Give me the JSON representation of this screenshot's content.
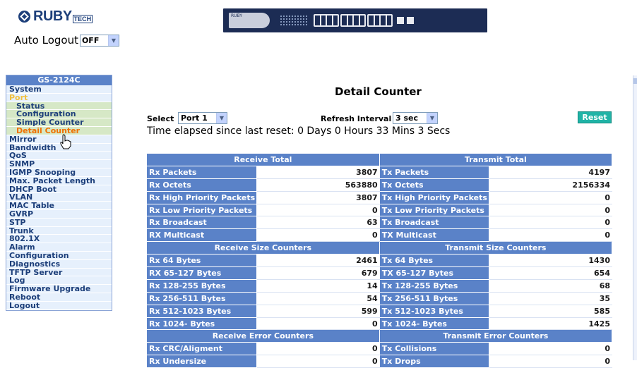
{
  "header": {
    "logo_text": "RUBY",
    "logo_sub": "TECH",
    "auto_logout_label": "Auto Logout",
    "auto_logout_value": "OFF",
    "switch_brand": "RUBY"
  },
  "sidebar": {
    "title": "GS-2124C",
    "items": [
      {
        "label": "System"
      },
      {
        "label": "Port",
        "open": true
      },
      {
        "label": "Status",
        "sub": true
      },
      {
        "label": "Configuration",
        "sub": true
      },
      {
        "label": "Simple Counter",
        "sub": true
      },
      {
        "label": "Detail Counter",
        "sub": true,
        "active": true
      },
      {
        "label": "Mirror"
      },
      {
        "label": "Bandwidth"
      },
      {
        "label": "QoS"
      },
      {
        "label": "SNMP"
      },
      {
        "label": "IGMP Snooping"
      },
      {
        "label": "Max. Packet Length"
      },
      {
        "label": "DHCP Boot"
      },
      {
        "label": "VLAN"
      },
      {
        "label": "MAC Table"
      },
      {
        "label": "GVRP"
      },
      {
        "label": "STP"
      },
      {
        "label": "Trunk"
      },
      {
        "label": "802.1X"
      },
      {
        "label": "Alarm"
      },
      {
        "label": "Configuration"
      },
      {
        "label": "Diagnostics"
      },
      {
        "label": "TFTP Server"
      },
      {
        "label": "Log"
      },
      {
        "label": "Firmware Upgrade"
      },
      {
        "label": "Reboot"
      },
      {
        "label": "Logout"
      }
    ]
  },
  "main": {
    "title": "Detail Counter",
    "select_label": "Select",
    "port_value": "Port 1",
    "refresh_label": "Refresh Interval",
    "refresh_value": "3 sec",
    "reset_label": "Reset",
    "elapsed": "Time elapsed since last reset: 0 Days 0 Hours 33 Mins 3 Secs"
  },
  "table": [
    {
      "type": "header",
      "left": "Receive Total",
      "right": "Transmit Total"
    },
    {
      "type": "row",
      "l_label": "Rx Packets",
      "l_value": "3807",
      "r_label": "Tx Packets",
      "r_value": "4197"
    },
    {
      "type": "row",
      "l_label": "Rx Octets",
      "l_value": "563880",
      "r_label": "Tx Octets",
      "r_value": "2156334"
    },
    {
      "type": "row",
      "l_label": "Rx High Priority Packets",
      "l_value": "3807",
      "r_label": "Tx High Priority Packets",
      "r_value": "0"
    },
    {
      "type": "row",
      "l_label": "Rx Low Priority Packets",
      "l_value": "0",
      "r_label": "Tx Low Priority Packets",
      "r_value": "0"
    },
    {
      "type": "row",
      "l_label": "Rx Broadcast",
      "l_value": "63",
      "r_label": "Tx Broadcast",
      "r_value": "0"
    },
    {
      "type": "row",
      "l_label": "RX Multicast",
      "l_value": "0",
      "r_label": "TX Multicast",
      "r_value": "0"
    },
    {
      "type": "header",
      "left": "Receive Size Counters",
      "right": "Transmit Size Counters"
    },
    {
      "type": "row",
      "l_label": "Rx 64 Bytes",
      "l_value": "2461",
      "r_label": "Tx 64 Bytes",
      "r_value": "1430"
    },
    {
      "type": "row",
      "l_label": "RX 65-127 Bytes",
      "l_value": "679",
      "r_label": "TX 65-127 Bytes",
      "r_value": "654"
    },
    {
      "type": "row",
      "l_label": "Rx 128-255 Bytes",
      "l_value": "14",
      "r_label": "Tx 128-255 Bytes",
      "r_value": "68"
    },
    {
      "type": "row",
      "l_label": "Rx 256-511 Bytes",
      "l_value": "54",
      "r_label": "Tx 256-511 Bytes",
      "r_value": "35"
    },
    {
      "type": "row",
      "l_label": "Rx 512-1023 Bytes",
      "l_value": "599",
      "r_label": "Tx 512-1023 Bytes",
      "r_value": "585"
    },
    {
      "type": "row",
      "l_label": "Rx 1024- Bytes",
      "l_value": "0",
      "r_label": "Tx 1024- Bytes",
      "r_value": "1425"
    },
    {
      "type": "header",
      "left": "Receive Error Counters",
      "right": "Transmit Error Counters"
    },
    {
      "type": "row",
      "l_label": "Rx CRC/Aligment",
      "l_value": "0",
      "r_label": "Tx Collisions",
      "r_value": "0"
    },
    {
      "type": "row",
      "l_label": "Rx Undersize",
      "l_value": "0",
      "r_label": "Tx Drops",
      "r_value": "0"
    }
  ],
  "colors": {
    "accent": "#5a82c8",
    "reset_button": "#20b3a6",
    "sidebar_bg": "#e6f0fc",
    "active_item": "#f07000"
  }
}
